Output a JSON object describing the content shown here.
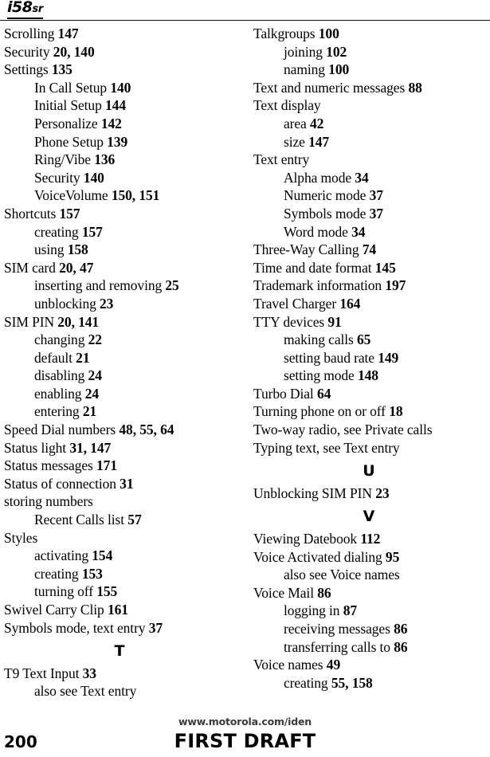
{
  "header": {
    "logo_main": "i58",
    "logo_suffix": "sr"
  },
  "columns": [
    {
      "name": "left",
      "blocks": [
        {
          "type": "entries",
          "entries": [
            {
              "level": 1,
              "text": "Scrolling ",
              "page_ref": "147"
            },
            {
              "level": 1,
              "text": "Security ",
              "page_ref": "20, 140"
            },
            {
              "level": 1,
              "text": "Settings ",
              "page_ref": "135"
            },
            {
              "level": 2,
              "text": "In Call Setup ",
              "page_ref": "140"
            },
            {
              "level": 2,
              "text": "Initial Setup ",
              "page_ref": "144"
            },
            {
              "level": 2,
              "text": "Personalize ",
              "page_ref": "142"
            },
            {
              "level": 2,
              "text": "Phone Setup ",
              "page_ref": "139"
            },
            {
              "level": 2,
              "text": "Ring/Vibe ",
              "page_ref": "136"
            },
            {
              "level": 2,
              "text": "Security ",
              "page_ref": "140"
            },
            {
              "level": 2,
              "text": "VoiceVolume ",
              "page_ref": "150, 151"
            },
            {
              "level": 1,
              "text": "Shortcuts ",
              "page_ref": "157"
            },
            {
              "level": 2,
              "text": "creating ",
              "page_ref": "157"
            },
            {
              "level": 2,
              "text": "using ",
              "page_ref": "158"
            },
            {
              "level": 1,
              "text": "SIM card ",
              "page_ref": "20, 47"
            },
            {
              "level": 2,
              "text": "inserting and removing ",
              "page_ref": "25"
            },
            {
              "level": 2,
              "text": "unblocking ",
              "page_ref": "23"
            },
            {
              "level": 1,
              "text": "SIM PIN ",
              "page_ref": "20, 141"
            },
            {
              "level": 2,
              "text": "changing ",
              "page_ref": "22"
            },
            {
              "level": 2,
              "text": "default ",
              "page_ref": "21"
            },
            {
              "level": 2,
              "text": "disabling ",
              "page_ref": "24"
            },
            {
              "level": 2,
              "text": "enabling ",
              "page_ref": "24"
            },
            {
              "level": 2,
              "text": "entering ",
              "page_ref": "21"
            },
            {
              "level": 1,
              "text": "Speed Dial numbers ",
              "page_ref": "48, 55, 64"
            },
            {
              "level": 1,
              "text": "Status light ",
              "page_ref": "31, 147"
            },
            {
              "level": 1,
              "text": "Status messages ",
              "page_ref": "171"
            },
            {
              "level": 1,
              "text": "Status of connection ",
              "page_ref": "31"
            },
            {
              "level": 1,
              "text": "storing numbers",
              "page_ref": ""
            },
            {
              "level": 2,
              "text": "Recent Calls list ",
              "page_ref": "57"
            },
            {
              "level": 1,
              "text": "Styles",
              "page_ref": ""
            },
            {
              "level": 2,
              "text": "activating ",
              "page_ref": "154"
            },
            {
              "level": 2,
              "text": "creating ",
              "page_ref": "153"
            },
            {
              "level": 2,
              "text": "turning off ",
              "page_ref": "155"
            },
            {
              "level": 1,
              "text": "Swivel Carry Clip ",
              "page_ref": "161"
            },
            {
              "level": 1,
              "text": "Symbols mode, text entry ",
              "page_ref": "37"
            }
          ]
        },
        {
          "type": "letter",
          "letter": "T"
        },
        {
          "type": "entries",
          "entries": [
            {
              "level": 1,
              "text": "T9 Text Input ",
              "page_ref": "33"
            },
            {
              "level": 2,
              "text": "also see Text entry",
              "page_ref": ""
            }
          ]
        }
      ]
    },
    {
      "name": "right",
      "blocks": [
        {
          "type": "entries",
          "entries": [
            {
              "level": 1,
              "text": "Talkgroups ",
              "page_ref": "100"
            },
            {
              "level": 2,
              "text": "joining ",
              "page_ref": "102"
            },
            {
              "level": 2,
              "text": "naming ",
              "page_ref": "100"
            },
            {
              "level": 1,
              "text": "Text and numeric messages ",
              "page_ref": "88"
            },
            {
              "level": 1,
              "text": "Text display",
              "page_ref": ""
            },
            {
              "level": 2,
              "text": "area ",
              "page_ref": "42"
            },
            {
              "level": 2,
              "text": "size ",
              "page_ref": "147"
            },
            {
              "level": 1,
              "text": "Text entry",
              "page_ref": ""
            },
            {
              "level": 2,
              "text": "Alpha mode ",
              "page_ref": "34"
            },
            {
              "level": 2,
              "text": "Numeric mode ",
              "page_ref": "37"
            },
            {
              "level": 2,
              "text": "Symbols mode ",
              "page_ref": "37"
            },
            {
              "level": 2,
              "text": "Word mode ",
              "page_ref": "34"
            },
            {
              "level": 1,
              "text": "Three-Way Calling ",
              "page_ref": "74"
            },
            {
              "level": 1,
              "text": "Time and date format ",
              "page_ref": "145"
            },
            {
              "level": 1,
              "text": "Trademark information ",
              "page_ref": "197"
            },
            {
              "level": 1,
              "text": "Travel Charger ",
              "page_ref": "164"
            },
            {
              "level": 1,
              "text": "TTY devices ",
              "page_ref": "91"
            },
            {
              "level": 2,
              "text": "making calls ",
              "page_ref": "65"
            },
            {
              "level": 2,
              "text": "setting baud rate ",
              "page_ref": "149"
            },
            {
              "level": 2,
              "text": "setting mode ",
              "page_ref": "148"
            },
            {
              "level": 1,
              "text": "Turbo Dial ",
              "page_ref": "64"
            },
            {
              "level": 1,
              "text": "Turning phone on or off ",
              "page_ref": "18"
            },
            {
              "level": 1,
              "text": "Two-way radio, see Private calls",
              "page_ref": ""
            },
            {
              "level": 1,
              "text": "Typing text, see Text entry",
              "page_ref": ""
            }
          ]
        },
        {
          "type": "letter",
          "letter": "U"
        },
        {
          "type": "entries",
          "entries": [
            {
              "level": 1,
              "text": "Unblocking SIM PIN ",
              "page_ref": "23"
            }
          ]
        },
        {
          "type": "letter",
          "letter": "V"
        },
        {
          "type": "entries",
          "entries": [
            {
              "level": 1,
              "text": "Viewing Datebook ",
              "page_ref": "112"
            },
            {
              "level": 1,
              "text": "Voice Activated dialing ",
              "page_ref": "95"
            },
            {
              "level": 2,
              "text": "also see Voice names",
              "page_ref": ""
            },
            {
              "level": 1,
              "text": "Voice Mail ",
              "page_ref": "86"
            },
            {
              "level": 2,
              "text": "logging in ",
              "page_ref": "87"
            },
            {
              "level": 2,
              "text": "receiving messages ",
              "page_ref": "86"
            },
            {
              "level": 2,
              "text": "transferring calls to ",
              "page_ref": "86"
            },
            {
              "level": 1,
              "text": "Voice names ",
              "page_ref": "49"
            },
            {
              "level": 2,
              "text": "creating ",
              "page_ref": "55, 158"
            }
          ]
        }
      ]
    }
  ],
  "footer": {
    "url": "www.motorola.com/iden",
    "page_number": "200",
    "draft_label": "FIRST DRAFT"
  }
}
